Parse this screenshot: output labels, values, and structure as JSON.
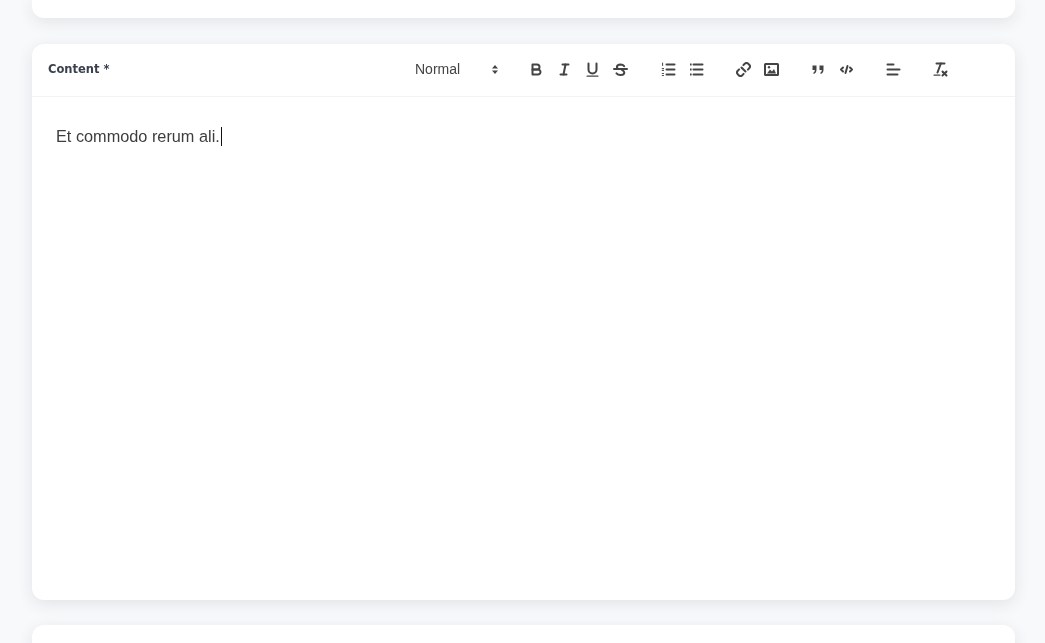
{
  "content_field": {
    "label": "Content *",
    "toolbar": {
      "format_select": {
        "value": "Normal"
      },
      "groups": [
        [
          {
            "kind": "bold"
          },
          {
            "kind": "italic"
          },
          {
            "kind": "underline"
          },
          {
            "kind": "strike"
          }
        ],
        [
          {
            "kind": "ordered-list"
          },
          {
            "kind": "bullet-list"
          }
        ],
        [
          {
            "kind": "link"
          },
          {
            "kind": "image"
          }
        ],
        [
          {
            "kind": "blockquote"
          },
          {
            "kind": "code-block"
          }
        ],
        [
          {
            "kind": "align"
          }
        ],
        [
          {
            "kind": "clean"
          }
        ]
      ]
    },
    "value": "Et commodo rerum ali.",
    "focused": true
  }
}
